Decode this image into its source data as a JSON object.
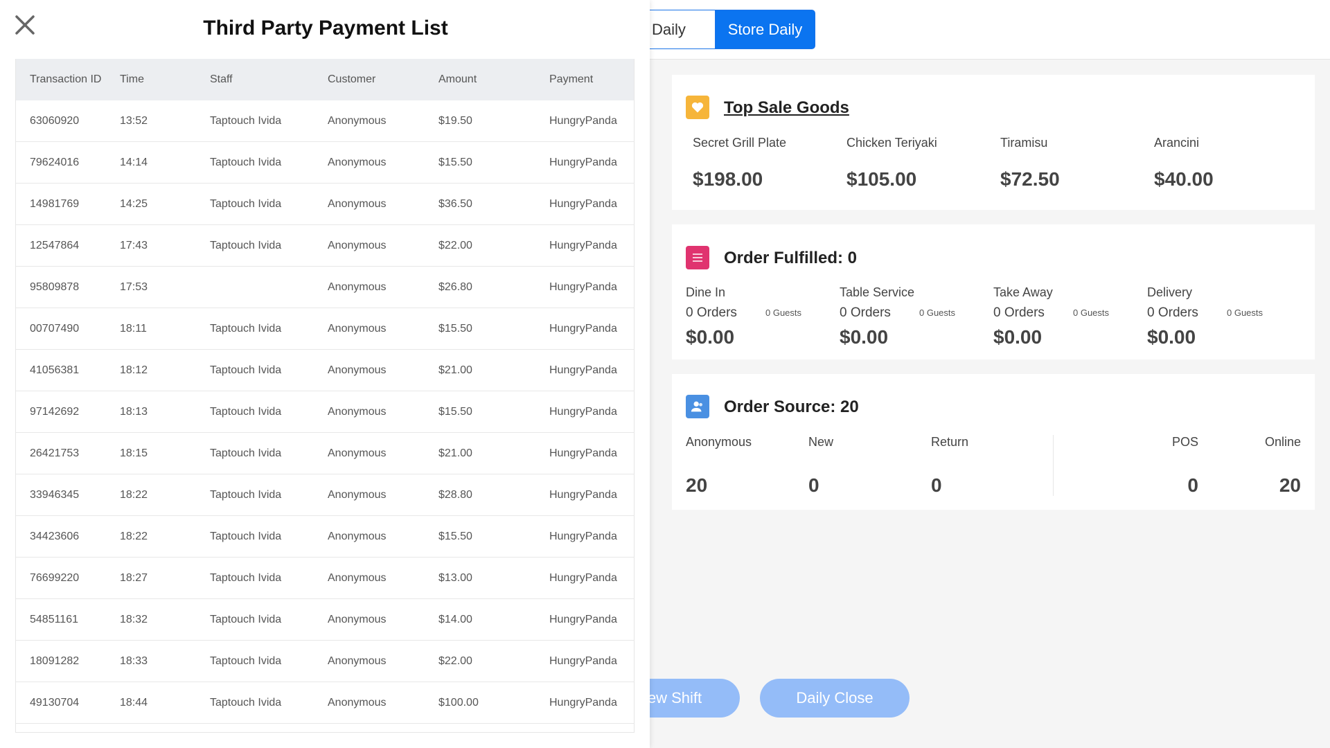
{
  "tabs": {
    "pos_daily": "OS Daily",
    "store_daily": "Store Daily"
  },
  "top_sale": {
    "title": "Top Sale Goods",
    "items": [
      {
        "name": "Secret Grill Plate",
        "value": "$198.00"
      },
      {
        "name": "Chicken Teriyaki",
        "value": "$105.00"
      },
      {
        "name": "Tiramisu",
        "value": "$72.50"
      },
      {
        "name": "Arancini",
        "value": "$40.00"
      }
    ]
  },
  "order_fulfilled": {
    "title": "Order Fulfilled: 0",
    "items": [
      {
        "label": "Dine In",
        "orders": "0 Orders",
        "guests": "0 Guests",
        "amount": "$0.00"
      },
      {
        "label": "Table Service",
        "orders": "0 Orders",
        "guests": "0 Guests",
        "amount": "$0.00"
      },
      {
        "label": "Take Away",
        "orders": "0 Orders",
        "guests": "0 Guests",
        "amount": "$0.00"
      },
      {
        "label": "Delivery",
        "orders": "0 Orders",
        "guests": "0 Guests",
        "amount": "$0.00"
      }
    ]
  },
  "order_source": {
    "title": "Order Source: 20",
    "items": [
      {
        "label": "Anonymous",
        "value": "20"
      },
      {
        "label": "New",
        "value": "0"
      },
      {
        "label": "Return",
        "value": "0"
      },
      {
        "label": "POS",
        "value": "0"
      },
      {
        "label": "Online",
        "value": "20"
      }
    ]
  },
  "actions": {
    "shift": "ew Shift",
    "daily_close": "Daily Close"
  },
  "modal": {
    "title": "Third Party Payment List",
    "columns": [
      "Transaction ID",
      "Time",
      "Staff",
      "Customer",
      "Amount",
      "Payment"
    ],
    "rows": [
      [
        "63060920",
        "13:52",
        "Taptouch Ivida",
        "Anonymous",
        "$19.50",
        "HungryPanda"
      ],
      [
        "79624016",
        "14:14",
        "Taptouch Ivida",
        "Anonymous",
        "$15.50",
        "HungryPanda"
      ],
      [
        "14981769",
        "14:25",
        "Taptouch Ivida",
        "Anonymous",
        "$36.50",
        "HungryPanda"
      ],
      [
        "12547864",
        "17:43",
        "Taptouch Ivida",
        "Anonymous",
        "$22.00",
        "HungryPanda"
      ],
      [
        "95809878",
        "17:53",
        "",
        "Anonymous",
        "$26.80",
        "HungryPanda"
      ],
      [
        "00707490",
        "18:11",
        "Taptouch Ivida",
        "Anonymous",
        "$15.50",
        "HungryPanda"
      ],
      [
        "41056381",
        "18:12",
        "Taptouch Ivida",
        "Anonymous",
        "$21.00",
        "HungryPanda"
      ],
      [
        "97142692",
        "18:13",
        "Taptouch Ivida",
        "Anonymous",
        "$15.50",
        "HungryPanda"
      ],
      [
        "26421753",
        "18:15",
        "Taptouch Ivida",
        "Anonymous",
        "$21.00",
        "HungryPanda"
      ],
      [
        "33946345",
        "18:22",
        "Taptouch Ivida",
        "Anonymous",
        "$28.80",
        "HungryPanda"
      ],
      [
        "34423606",
        "18:22",
        "Taptouch Ivida",
        "Anonymous",
        "$15.50",
        "HungryPanda"
      ],
      [
        "76699220",
        "18:27",
        "Taptouch Ivida",
        "Anonymous",
        "$13.00",
        "HungryPanda"
      ],
      [
        "54851161",
        "18:32",
        "Taptouch Ivida",
        "Anonymous",
        "$14.00",
        "HungryPanda"
      ],
      [
        "18091282",
        "18:33",
        "Taptouch Ivida",
        "Anonymous",
        "$22.00",
        "HungryPanda"
      ],
      [
        "49130704",
        "18:44",
        "Taptouch Ivida",
        "Anonymous",
        "$100.00",
        "HungryPanda"
      ]
    ]
  }
}
